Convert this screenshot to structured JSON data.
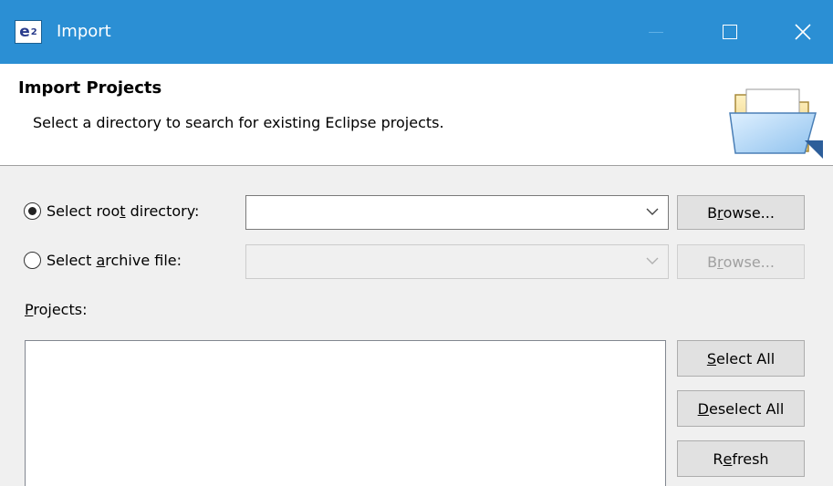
{
  "window": {
    "title": "Import",
    "icon": "eclipse-e2-icon",
    "controls": [
      "minimize-icon",
      "maximize-icon",
      "close-icon"
    ]
  },
  "banner": {
    "title": "Import Projects",
    "description": "Select a directory to search for existing Eclipse projects.",
    "icon": "folder-open-icon"
  },
  "source": {
    "root": {
      "label_pre": "Select roo",
      "label_mnemonic": "t",
      "label_post": " directory:",
      "selected": true,
      "value": ""
    },
    "archive": {
      "label_pre": "Select ",
      "label_mnemonic": "a",
      "label_post": "rchive file:",
      "selected": false,
      "value": ""
    },
    "browse": {
      "label_pre": "B",
      "label_mnemonic": "r",
      "label_post": "owse..."
    }
  },
  "projects": {
    "label_mnemonic": "P",
    "label_post": "rojects:",
    "items": []
  },
  "actions": {
    "select_all": {
      "label_mnemonic": "S",
      "label_post": "elect All"
    },
    "deselect_all": {
      "label_mnemonic": "D",
      "label_post": "eselect All"
    },
    "refresh": {
      "label_pre": "R",
      "label_mnemonic": "e",
      "label_post": "fresh"
    }
  },
  "colors": {
    "titlebar": "#2b8fd4",
    "dialog_bg": "#f0f0f0"
  }
}
